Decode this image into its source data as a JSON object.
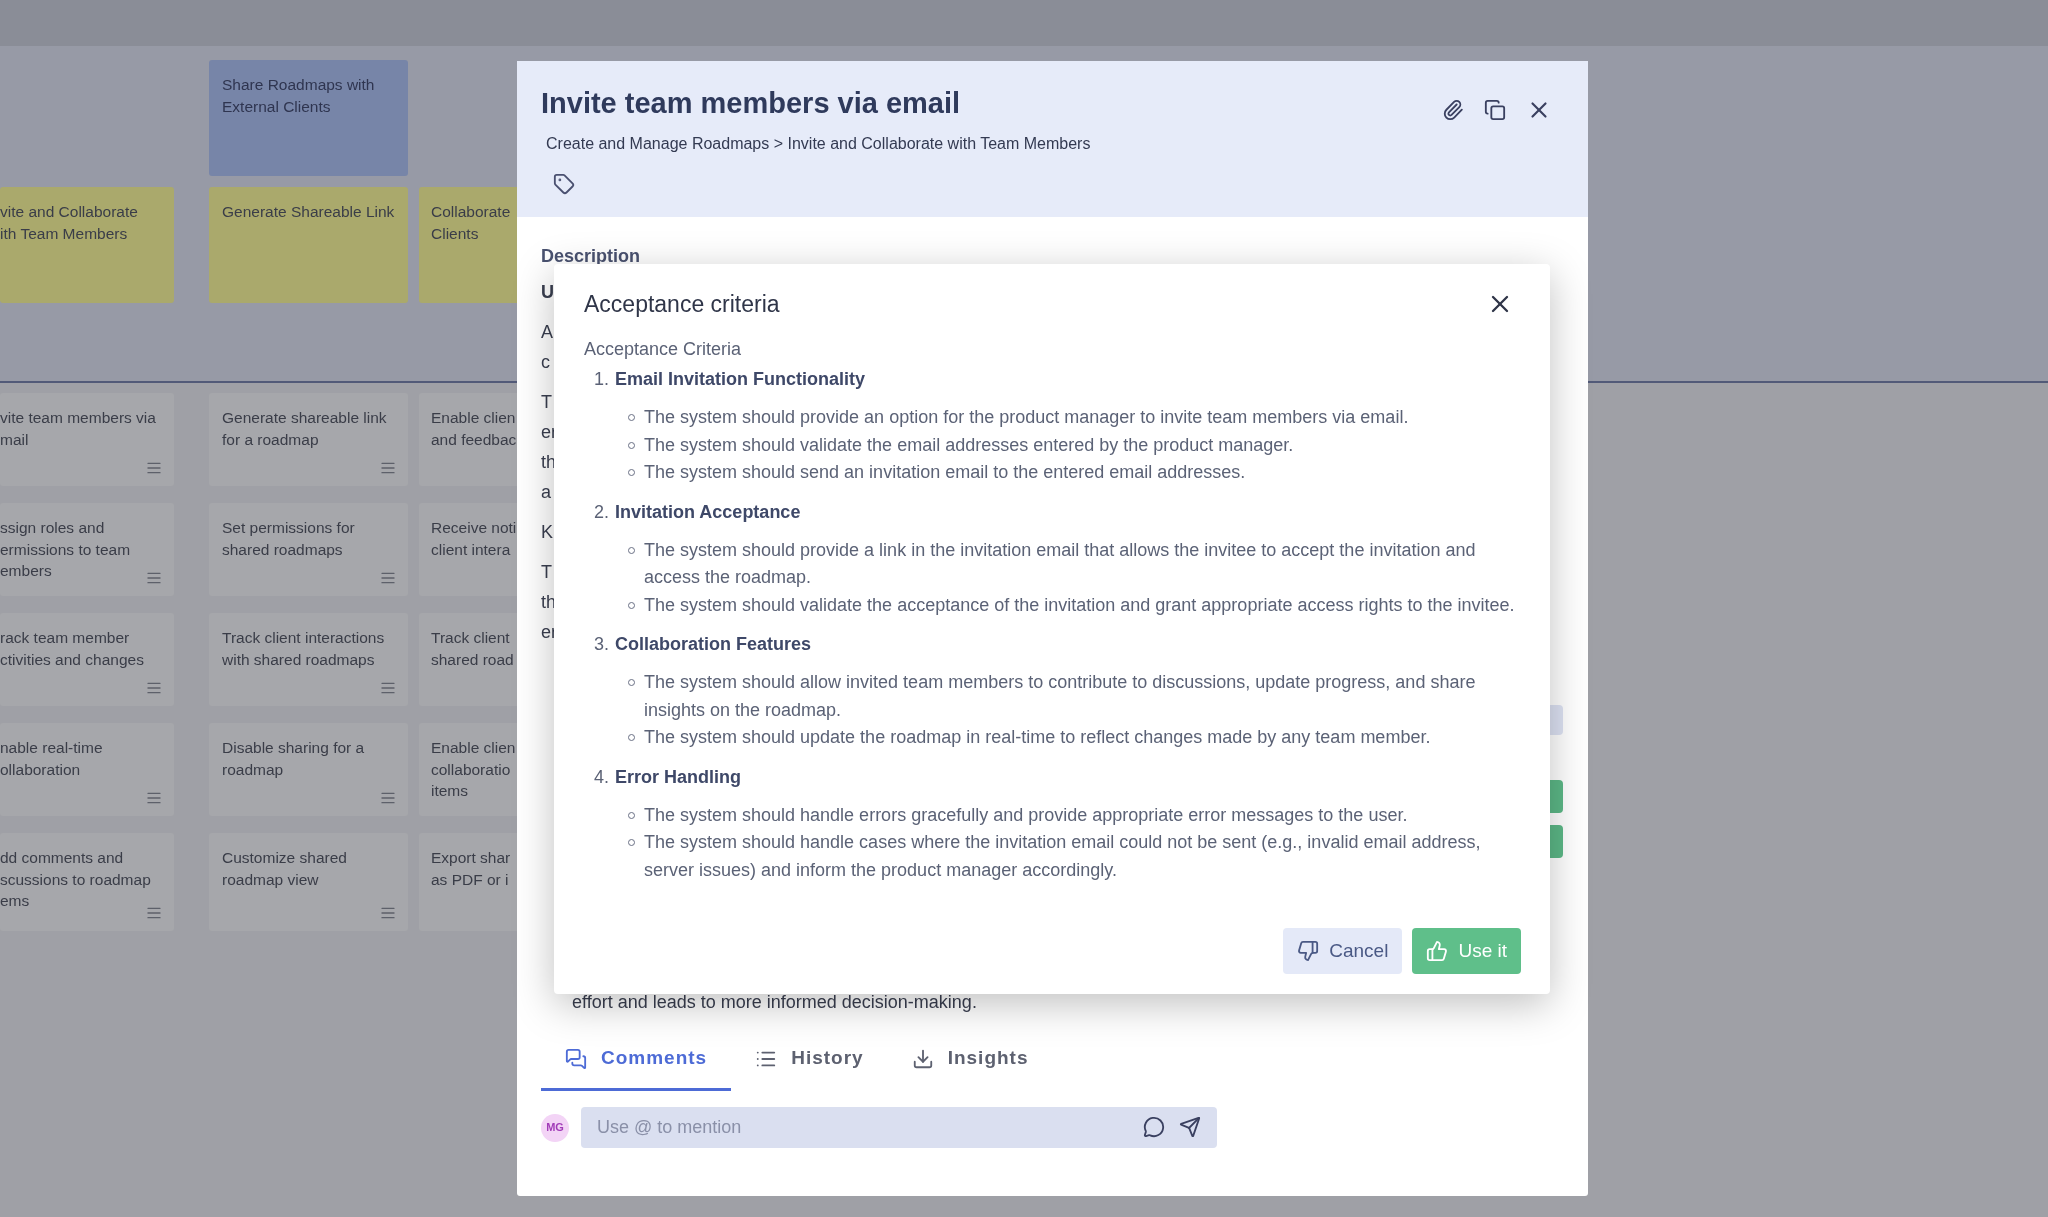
{
  "board": {
    "epic_row": [
      {
        "text": "Share Roadmaps with\nExternal Clients"
      }
    ],
    "feature_row": [
      {
        "text": "vite and Collaborate\nith Team Members"
      },
      {
        "text": "Generate Shareable Link"
      },
      {
        "text": "Collaborate\nClients"
      }
    ],
    "story_rows": [
      [
        {
          "text": "vite team members via\nmail",
          "menu": true
        },
        {
          "text": "Generate shareable link\nfor a roadmap",
          "menu": true
        },
        {
          "text": "Enable clien\nand feedbac"
        }
      ],
      [
        {
          "text": "ssign roles and\nermissions to team\nembers",
          "menu": true
        },
        {
          "text": "Set permissions for\nshared roadmaps",
          "menu": true
        },
        {
          "text": "Receive noti\nclient intera"
        }
      ],
      [
        {
          "text": "rack team member\nctivities and changes",
          "menu": true
        },
        {
          "text": "Track client interactions\nwith shared roadmaps",
          "menu": true
        },
        {
          "text": "Track client\nshared road"
        }
      ],
      [
        {
          "text": "nable real-time\nollaboration",
          "menu": true
        },
        {
          "text": "Disable sharing for a\nroadmap",
          "menu": true
        },
        {
          "text": "Enable clien\ncollaboratio\nitems"
        }
      ],
      [
        {
          "text": "dd comments and\nscussions to roadmap\nems",
          "menu": true
        },
        {
          "text": "Customize shared\nroadmap view",
          "menu": true
        },
        {
          "text": "Export shar\nas PDF or i"
        }
      ]
    ]
  },
  "panel": {
    "title": "Invite team members via email",
    "breadcrumb": "Create and Manage Roadmaps > Invite and Collaborate with Team Members",
    "description_label": "Description",
    "description_fragments": [
      {
        "kind": "heading",
        "lines": [
          "U"
        ]
      },
      {
        "kind": "paragraph",
        "lines": [
          "A",
          "c"
        ]
      },
      {
        "kind": "paragraph",
        "lines": [
          "T",
          "er",
          "th",
          "a"
        ]
      },
      {
        "kind": "paragraph",
        "lines": [
          "K"
        ]
      },
      {
        "kind": "paragraph",
        "lines": [
          "T",
          "th",
          "er"
        ]
      }
    ],
    "hidden_controls": [
      {
        "kind": "field"
      },
      {
        "kind": "button"
      },
      {
        "kind": "button"
      }
    ],
    "trailing_line": "effort and leads to more informed decision-making.",
    "tabs": [
      {
        "label": "Comments",
        "selected": true
      },
      {
        "label": "History",
        "selected": false
      },
      {
        "label": "Insights",
        "selected": false
      }
    ],
    "comment": {
      "avatar": "MG",
      "placeholder": "Use @ to mention"
    }
  },
  "dialog": {
    "title": "Acceptance criteria",
    "intro": "Acceptance Criteria",
    "sections": [
      {
        "number": "1.",
        "heading": "Email Invitation Functionality",
        "bullets": [
          "The system should provide an option for the product manager to invite team members via email.",
          "The system should validate the email addresses entered by the product manager.",
          "The system should send an invitation email to the entered email addresses."
        ]
      },
      {
        "number": "2.",
        "heading": "Invitation Acceptance",
        "bullets": [
          "The system should provide a link in the invitation email that allows the invitee to accept the invitation and access the roadmap.",
          "The system should validate the acceptance of the invitation and grant appropriate access rights to the invitee."
        ]
      },
      {
        "number": "3.",
        "heading": "Collaboration Features",
        "bullets": [
          "The system should allow invited team members to contribute to discussions, update progress, and share insights on the roadmap.",
          "The system should update the roadmap in real-time to reflect changes made by any team member."
        ]
      },
      {
        "number": "4.",
        "heading": "Error Handling",
        "bullets": [
          "The system should handle errors gracefully and provide appropriate error messages to the user.",
          "The system should handle cases where the invitation email could not be sent (e.g., invalid email address, server issues) and inform the product manager accordingly."
        ]
      }
    ],
    "buttons": [
      {
        "label": "Cancel",
        "kind": "secondary"
      },
      {
        "label": "Use it",
        "kind": "primary"
      }
    ]
  }
}
